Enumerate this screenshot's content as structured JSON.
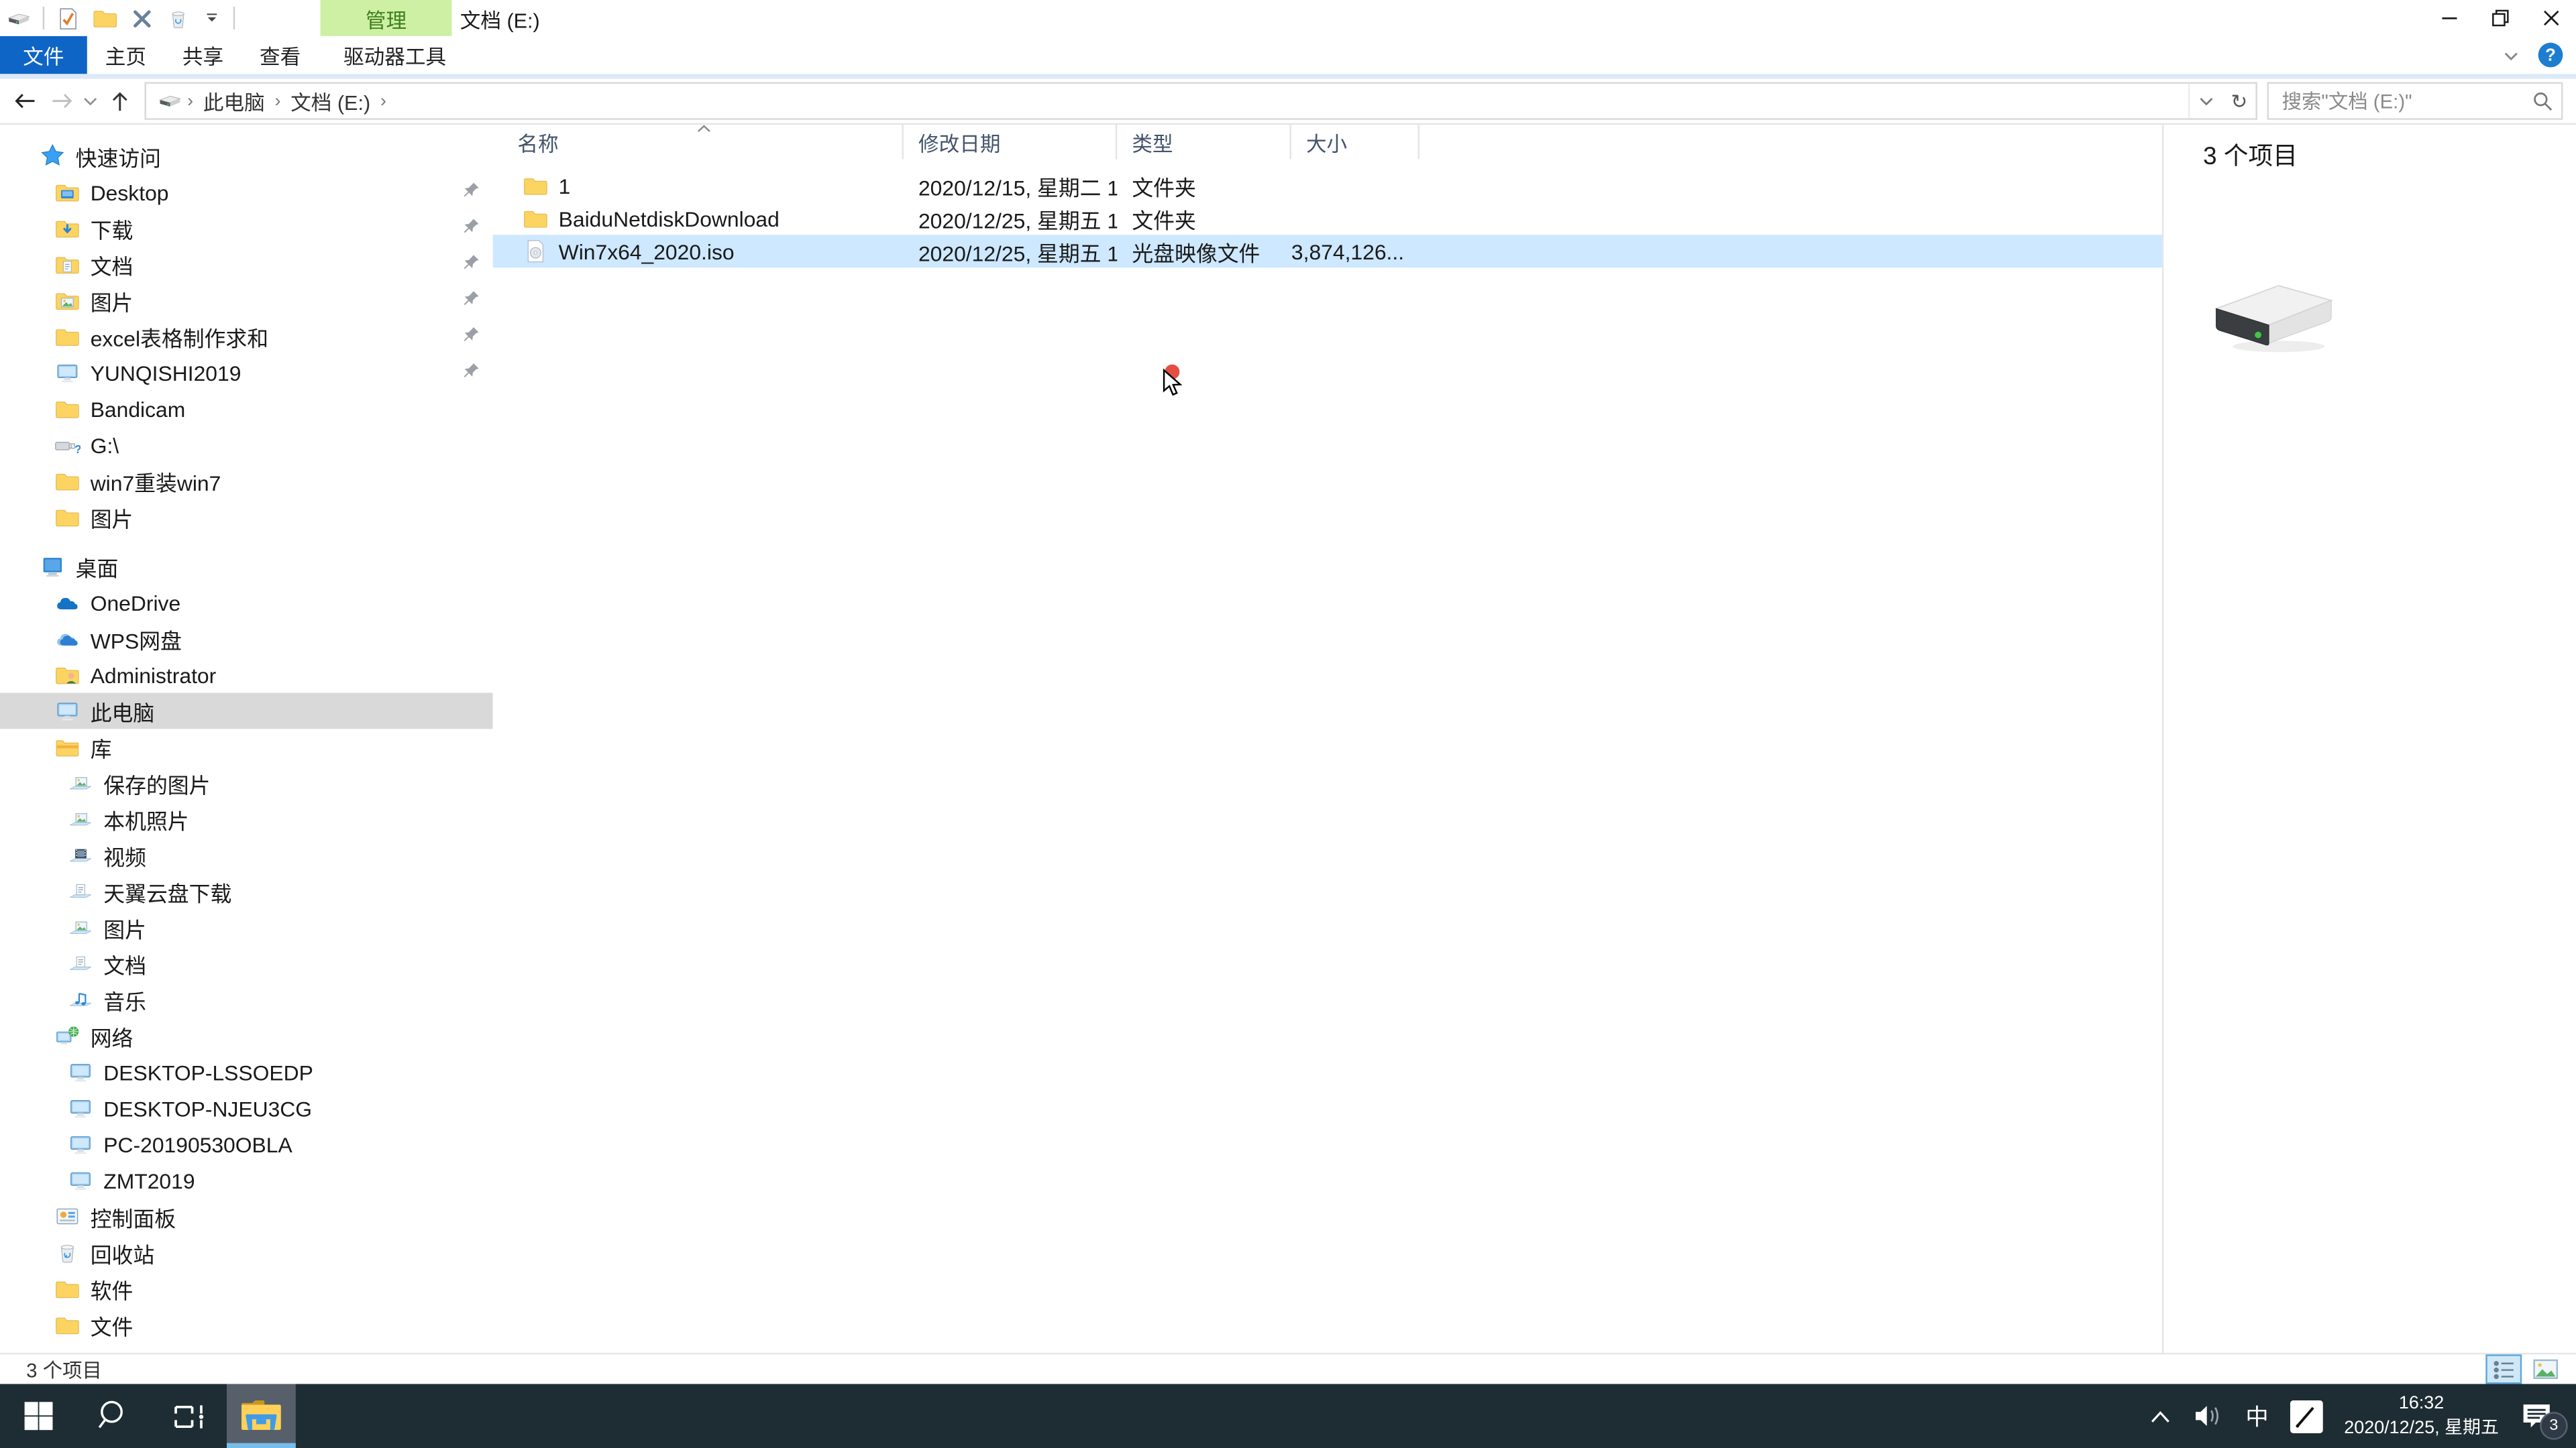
{
  "window": {
    "title": "文档 (E:)",
    "contextual_tab_group": "管理",
    "qat_icons": [
      "drive-icon",
      "properties-check-icon",
      "new-folder-icon",
      "delete-x-icon",
      "recycle-bin-icon",
      "qat-dropdown-icon"
    ],
    "controls": [
      "minimize",
      "restore",
      "close"
    ]
  },
  "ribbon": {
    "tabs": [
      {
        "label": "文件",
        "style": "file"
      },
      {
        "label": "主页",
        "style": ""
      },
      {
        "label": "共享",
        "style": ""
      },
      {
        "label": "查看",
        "style": ""
      },
      {
        "label": "驱动器工具",
        "style": "contextual"
      }
    ]
  },
  "navbar": {
    "breadcrumb_items": [
      "此电脑",
      "文档 (E:)"
    ],
    "search": {
      "placeholder": "搜索\"文档 (E:)\""
    }
  },
  "sidebar": {
    "items": [
      {
        "label": "快速访问",
        "icon": "quick-access-star",
        "level": 0
      },
      {
        "label": "Desktop",
        "icon": "folder-desktop",
        "level": 1,
        "pinned": true
      },
      {
        "label": "下载",
        "icon": "folder-download",
        "level": 1,
        "pinned": true
      },
      {
        "label": "文档",
        "icon": "folder-document",
        "level": 1,
        "pinned": true
      },
      {
        "label": "图片",
        "icon": "folder-picture",
        "level": 1,
        "pinned": true
      },
      {
        "label": "excel表格制作求和",
        "icon": "folder",
        "level": 1,
        "pinned": true
      },
      {
        "label": "YUNQISHI2019",
        "icon": "computer",
        "level": 1,
        "pinned": true
      },
      {
        "label": "Bandicam",
        "icon": "folder",
        "level": 1
      },
      {
        "label": "G:\\",
        "icon": "usb-drive",
        "level": 1
      },
      {
        "label": "win7重装win7",
        "icon": "folder",
        "level": 1
      },
      {
        "label": "图片",
        "icon": "folder",
        "level": 1
      },
      {
        "label": "桌面",
        "icon": "desktop-screen",
        "level": 0,
        "gap_before": true
      },
      {
        "label": "OneDrive",
        "icon": "onedrive-cloud",
        "level": 1
      },
      {
        "label": "WPS网盘",
        "icon": "wps-cloud",
        "level": 1
      },
      {
        "label": "Administrator",
        "icon": "user-folder",
        "level": 1
      },
      {
        "label": "此电脑",
        "icon": "computer",
        "level": 1,
        "selected": true
      },
      {
        "label": "库",
        "icon": "library",
        "level": 1
      },
      {
        "label": "保存的图片",
        "icon": "lib-pictures",
        "level": 2
      },
      {
        "label": "本机照片",
        "icon": "lib-pictures",
        "level": 2
      },
      {
        "label": "视频",
        "icon": "lib-videos",
        "level": 2
      },
      {
        "label": "天翼云盘下载",
        "icon": "lib-documents",
        "level": 2
      },
      {
        "label": "图片",
        "icon": "lib-pictures",
        "level": 2
      },
      {
        "label": "文档",
        "icon": "lib-documents",
        "level": 2
      },
      {
        "label": "音乐",
        "icon": "lib-music",
        "level": 2
      },
      {
        "label": "网络",
        "icon": "network",
        "level": 1
      },
      {
        "label": "DESKTOP-LSSOEDP",
        "icon": "computer",
        "level": 2
      },
      {
        "label": "DESKTOP-NJEU3CG",
        "icon": "computer",
        "level": 2
      },
      {
        "label": "PC-20190530OBLA",
        "icon": "computer",
        "level": 2
      },
      {
        "label": "ZMT2019",
        "icon": "computer",
        "level": 2
      },
      {
        "label": "控制面板",
        "icon": "control-panel",
        "level": 1
      },
      {
        "label": "回收站",
        "icon": "recycle-bin",
        "level": 1
      },
      {
        "label": "软件",
        "icon": "folder",
        "level": 1
      },
      {
        "label": "文件",
        "icon": "folder",
        "level": 1
      }
    ]
  },
  "files": {
    "columns": [
      "名称",
      "修改日期",
      "类型",
      "大小"
    ],
    "sorted_column": "名称",
    "rows": [
      {
        "icon": "folder",
        "name": "1",
        "date": "2020/12/15, 星期二 1...",
        "type": "文件夹",
        "size": ""
      },
      {
        "icon": "folder",
        "name": "BaiduNetdiskDownload",
        "date": "2020/12/25, 星期五 1...",
        "type": "文件夹",
        "size": ""
      },
      {
        "icon": "iso-file",
        "name": "Win7x64_2020.iso",
        "date": "2020/12/25, 星期五 1...",
        "type": "光盘映像文件",
        "size": "3,874,126...",
        "selected": true
      }
    ]
  },
  "preview": {
    "count": "3 个项目"
  },
  "statusbar": {
    "count": "3 个项目"
  },
  "taskbar": {
    "time": "16:32",
    "date": "2020/12/25, 星期五",
    "ime_label": "中",
    "notification_count": "3"
  },
  "colors": {
    "accent_blue": "#0e65c5",
    "contextual_green_bg": "#cdf0a4",
    "contextual_green_text": "#417f1f",
    "selection_blue": "#cde8ff",
    "sidebar_selection_gray": "#d9d9d9",
    "taskbar_bg": "#1e2d33",
    "taskbar_active_underline": "#76bdea"
  }
}
